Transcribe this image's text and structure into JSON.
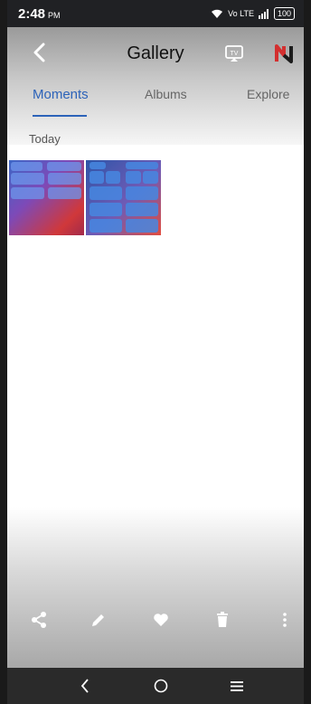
{
  "status_bar": {
    "time": "2:48",
    "ampm": "PM",
    "network": "Vo LTE",
    "battery": "100"
  },
  "header": {
    "title": "Gallery",
    "back_icon": "chevron-left-icon",
    "cast_icon": "tv-cast-icon",
    "app_icon": "n-logo-icon"
  },
  "tabs": [
    {
      "label": "Moments",
      "active": true
    },
    {
      "label": "Albums",
      "active": false
    },
    {
      "label": "Explore",
      "active": false
    }
  ],
  "section": {
    "label": "Today"
  },
  "photos": [
    {
      "name": "control-center-screenshot-1"
    },
    {
      "name": "control-center-screenshot-2"
    }
  ],
  "toolbar": {
    "icons": [
      "share-icon",
      "edit-icon",
      "favorite-icon",
      "delete-icon",
      "more-icon"
    ]
  },
  "nav": {
    "icons": [
      "back-icon",
      "home-icon",
      "recents-icon"
    ]
  },
  "colors": {
    "accent": "#2d63b9",
    "status_bar": "#202124",
    "nav_bar": "#2a2a2a"
  }
}
